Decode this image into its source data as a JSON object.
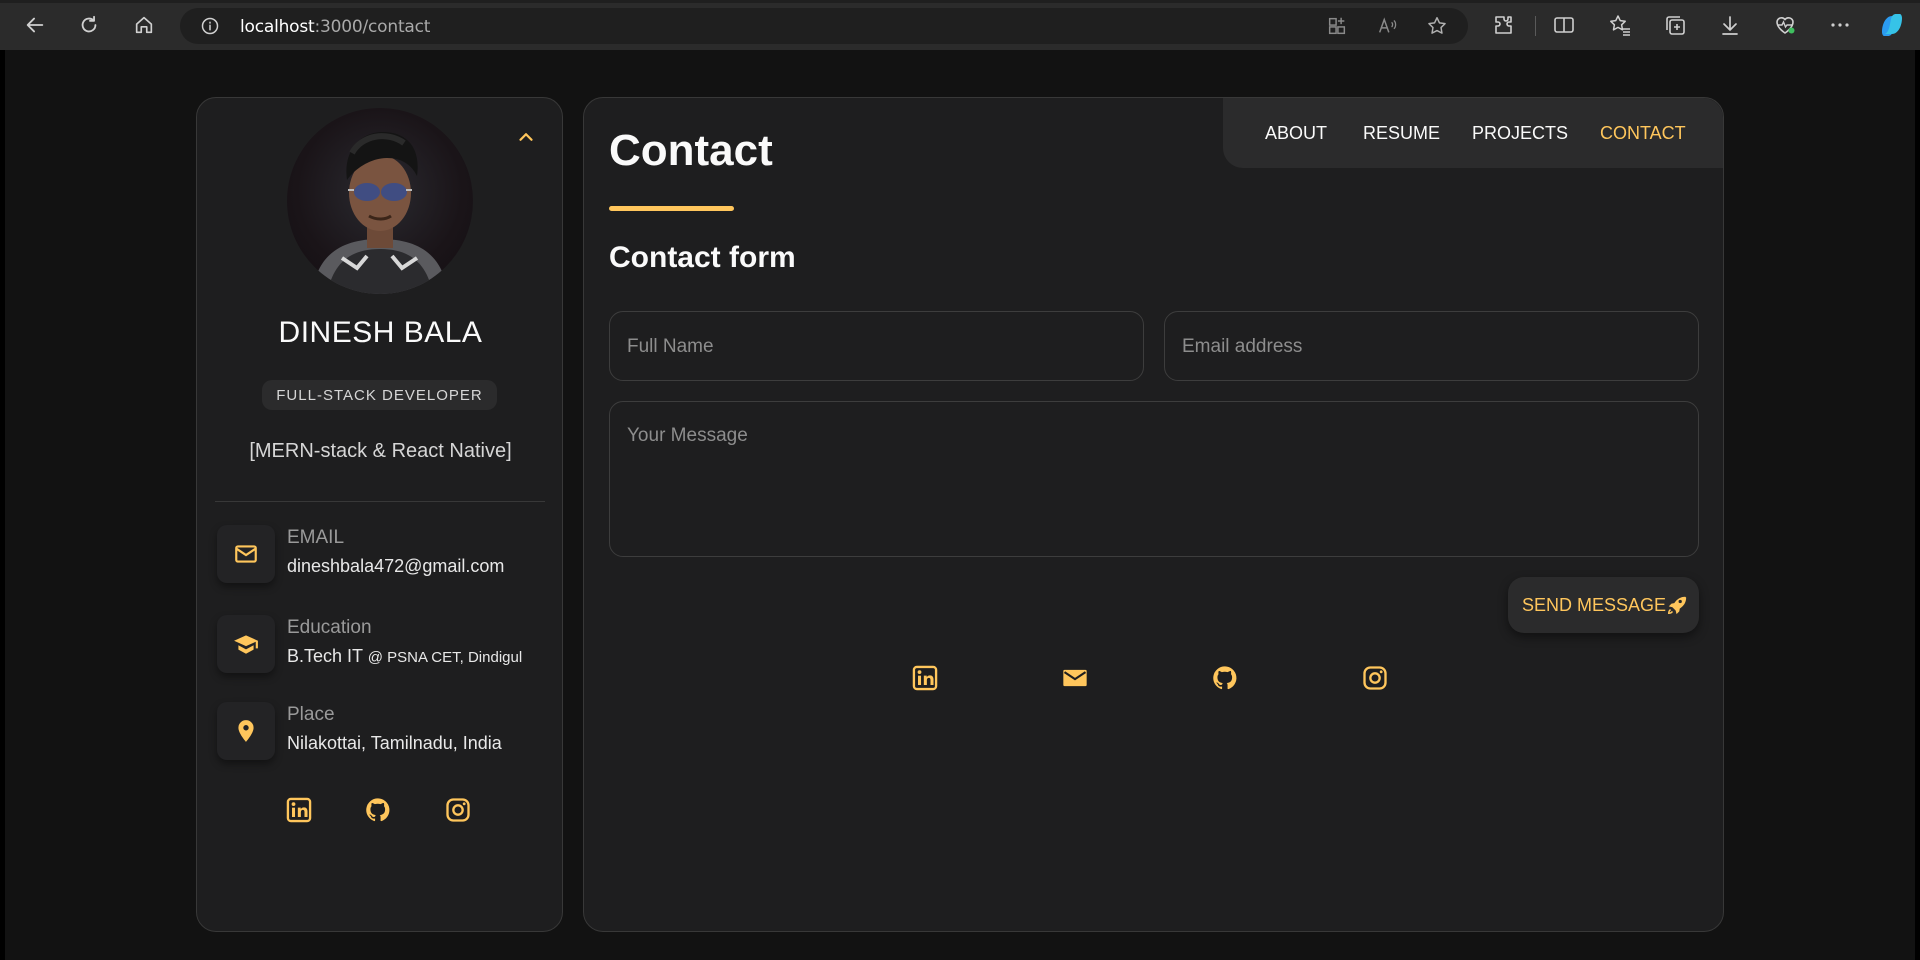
{
  "browser": {
    "url_host": "localhost",
    "url_path": ":3000/contact"
  },
  "profile": {
    "name": "DINESH BALA",
    "title_badge": "FULL-STACK DEVELOPER",
    "stack": "[MERN-stack & React Native]",
    "contacts": [
      {
        "icon": "mail-icon",
        "label": "EMAIL",
        "value": "dineshbala472@gmail.com",
        "value_small": ""
      },
      {
        "icon": "graduation-cap-icon",
        "label": "Education",
        "value": "B.Tech IT",
        "value_small": "@ PSNA CET, Dindigul"
      },
      {
        "icon": "location-pin-icon",
        "label": "Place",
        "value": "Nilakottai, Tamilnadu, India",
        "value_small": ""
      }
    ]
  },
  "navbar": {
    "about": "ABOUT",
    "resume": "RESUME",
    "projects": "PROJECTS",
    "contact": "CONTACT"
  },
  "article": {
    "title": "Contact",
    "form_title": "Contact form",
    "full_name_placeholder": "Full Name",
    "email_placeholder": "Email address",
    "message_placeholder": "Your Message",
    "send_label": "SEND MESSAGE"
  },
  "colors": {
    "accent": "#ffc65c",
    "background": "#121212",
    "card": "#1e1e1f"
  }
}
